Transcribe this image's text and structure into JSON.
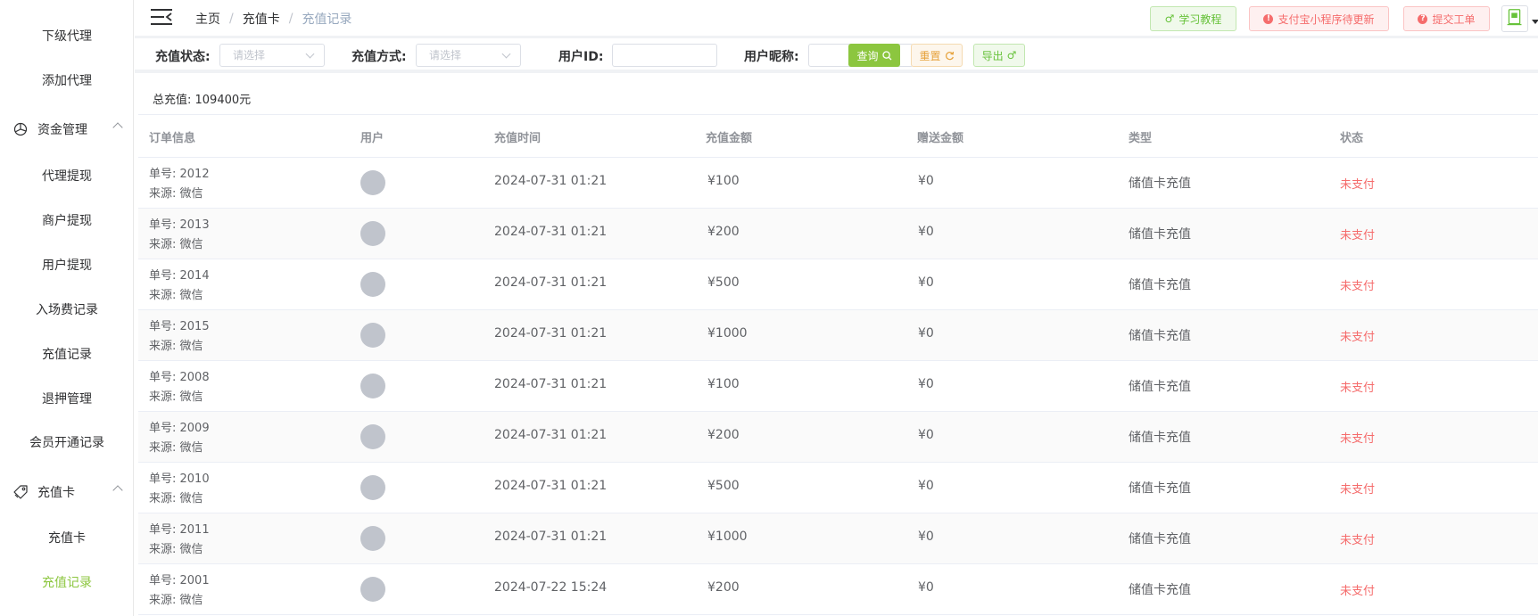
{
  "sidebar": {
    "items_top": [
      "下级代理",
      "添加代理"
    ],
    "group_funds": "资金管理",
    "funds_items": [
      "代理提现",
      "商户提现",
      "用户提现",
      "入场费记录",
      "充值记录",
      "退押管理",
      "会员开通记录"
    ],
    "group_card": "充值卡",
    "card_items": [
      "充值卡",
      "充值记录"
    ],
    "active_color": "#8cc63f"
  },
  "header": {
    "breadcrumb": [
      "主页",
      "充值卡",
      "充值记录"
    ],
    "btn_tutorial": "学习教程",
    "btn_alipay": "支付宝小程序待更新",
    "btn_ticket": "提交工单"
  },
  "filter": {
    "status_label": "充值状态:",
    "status_placeholder": "请选择",
    "method_label": "充值方式:",
    "method_placeholder": "请选择",
    "userid_label": "用户ID:",
    "nickname_label": "用户昵称:",
    "btn_query": "查询",
    "btn_reset": "重置",
    "btn_export": "导出"
  },
  "summary": {
    "total": "总充值: 109400元"
  },
  "table": {
    "headers": [
      "订单信息",
      "用户",
      "充值时间",
      "充值金额",
      "赠送金额",
      "类型",
      "状态"
    ],
    "rows": [
      {
        "order": "单号: 2012",
        "source": "来源: 微信",
        "time": "2024-07-31 01:21",
        "amount": "¥100",
        "gift": "¥0",
        "type": "储值卡充值",
        "status": "未支付"
      },
      {
        "order": "单号: 2013",
        "source": "来源: 微信",
        "time": "2024-07-31 01:21",
        "amount": "¥200",
        "gift": "¥0",
        "type": "储值卡充值",
        "status": "未支付"
      },
      {
        "order": "单号: 2014",
        "source": "来源: 微信",
        "time": "2024-07-31 01:21",
        "amount": "¥500",
        "gift": "¥0",
        "type": "储值卡充值",
        "status": "未支付"
      },
      {
        "order": "单号: 2015",
        "source": "来源: 微信",
        "time": "2024-07-31 01:21",
        "amount": "¥1000",
        "gift": "¥0",
        "type": "储值卡充值",
        "status": "未支付"
      },
      {
        "order": "单号: 2008",
        "source": "来源: 微信",
        "time": "2024-07-31 01:21",
        "amount": "¥100",
        "gift": "¥0",
        "type": "储值卡充值",
        "status": "未支付"
      },
      {
        "order": "单号: 2009",
        "source": "来源: 微信",
        "time": "2024-07-31 01:21",
        "amount": "¥200",
        "gift": "¥0",
        "type": "储值卡充值",
        "status": "未支付"
      },
      {
        "order": "单号: 2010",
        "source": "来源: 微信",
        "time": "2024-07-31 01:21",
        "amount": "¥500",
        "gift": "¥0",
        "type": "储值卡充值",
        "status": "未支付"
      },
      {
        "order": "单号: 2011",
        "source": "来源: 微信",
        "time": "2024-07-31 01:21",
        "amount": "¥1000",
        "gift": "¥0",
        "type": "储值卡充值",
        "status": "未支付"
      },
      {
        "order": "单号: 2001",
        "source": "来源: 微信",
        "time": "2024-07-22 15:24",
        "amount": "¥200",
        "gift": "¥0",
        "type": "储值卡充值",
        "status": "未支付"
      }
    ]
  }
}
